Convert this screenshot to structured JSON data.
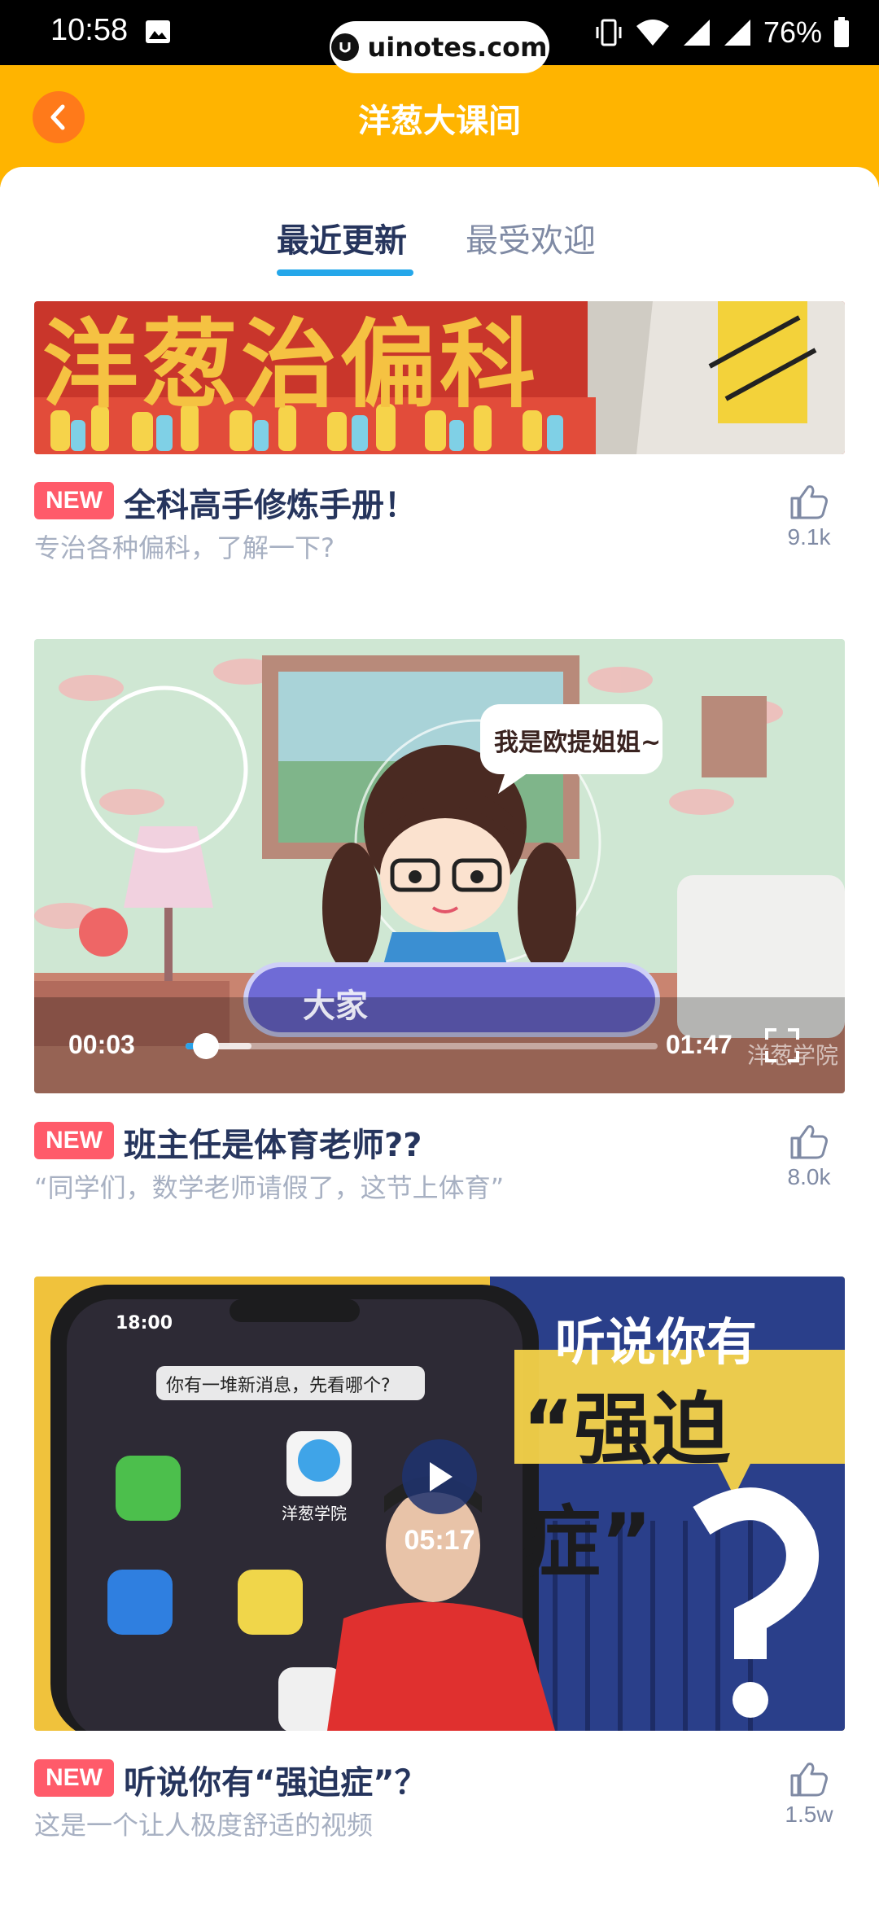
{
  "status_bar": {
    "time": "10:58",
    "battery": "76%",
    "url": "uinotes.com"
  },
  "header": {
    "title": "洋葱大课间"
  },
  "tabs": [
    {
      "label": "最近更新",
      "active": true
    },
    {
      "label": "最受欢迎",
      "active": false
    }
  ],
  "items": [
    {
      "badge": "NEW",
      "title": "全科高手修炼手册！",
      "subtitle": "专治各种偏科，了解一下?",
      "likes": "9.1k",
      "thumb_text": "洋葱治偏科"
    },
    {
      "badge": "NEW",
      "title": "班主任是体育老师??",
      "subtitle": "“同学们，数学老师请假了，这节上体育”",
      "likes": "8.0k",
      "video": {
        "current_time": "00:03",
        "duration": "01:47",
        "progress": 0.03,
        "buffered": 0.14,
        "bubble_text": "我是欧提姐姐~",
        "caption_text": "大家",
        "watermark": "洋葱学院"
      }
    },
    {
      "badge": "NEW",
      "title": "听说你有“强迫症”？",
      "subtitle": "这是一个让人极度舒适的视频",
      "likes": "1.5w",
      "video": {
        "duration": "05:17",
        "headline": "听说你有",
        "headline_big": "“强迫症”",
        "phone_time": "18:00",
        "phone_banner": "你有一堆新消息，先看哪个?",
        "app_label": "洋葱学院"
      }
    }
  ],
  "colors": {
    "header_bg": "#ffb400",
    "back_button": "#ff7a1a",
    "tab_active": "#26355d",
    "tab_inactive": "#7f8aa4",
    "tab_underline": "#25a7ea",
    "badge_bg": "#ff5b6a"
  }
}
